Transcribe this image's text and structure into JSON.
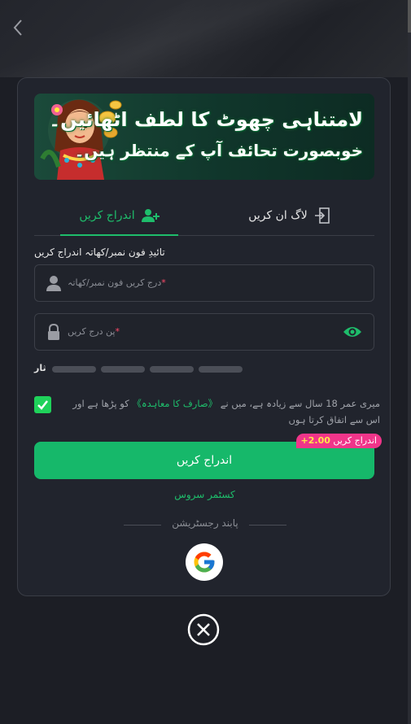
{
  "banner": {
    "line1": "لامتناہی چھوٹ کا لطف اٹھائیں۔",
    "line2": "خوبصورت تحائف آپ کے منتظر ہیں۔"
  },
  "tabs": {
    "register": "اندراج کریں",
    "login": "لاگ ان کریں"
  },
  "form": {
    "field_label": "تائیدِ فون نمبر/کھاتہ اندراج کریں",
    "account_placeholder": "درج کریں فون نمبر/کھاتہ",
    "password_placeholder": "پن درج کریں",
    "required_mark": "*",
    "strength_label": "ثار"
  },
  "terms": {
    "before": "میری عمر 18 سال سے زیادہ ہے، میں نے",
    "link": "《صارف کا معاہدہ》",
    "after": "کو پڑھا ہے اور اس سے اتفاق کرتا ہوں"
  },
  "submit": {
    "label": "اندراج کریں",
    "bonus_text": "اندراج کریں",
    "bonus_value": "+2.00"
  },
  "customer_service": "کسٹمر سروس",
  "or_text": "پابند رجسٹریشن",
  "colors": {
    "accent": "#1ebd6b",
    "button": "#16b86a",
    "checkbox": "#1fd25a",
    "badge": "#f0358a",
    "background": "#1c1e25",
    "panel": "#21242d"
  },
  "icons": {
    "back": "chevron-left-icon",
    "add_user": "add-user-icon",
    "login": "login-door-icon",
    "user": "user-icon",
    "lock": "lock-icon",
    "eye": "eye-icon",
    "check": "check-icon",
    "google": "google-icon",
    "close": "close-circle-icon"
  }
}
